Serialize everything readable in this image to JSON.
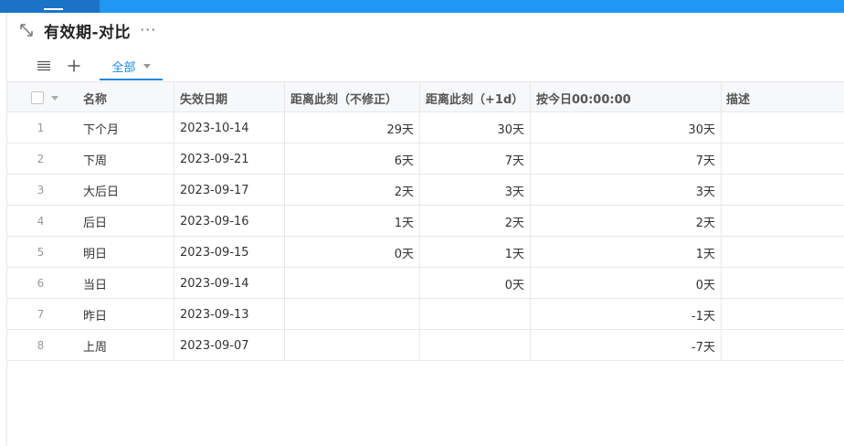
{
  "header": {
    "title": "有效期-对比",
    "more_label": "···"
  },
  "toolbar": {
    "view_tab_label": "全部"
  },
  "table": {
    "columns": [
      "名称",
      "失效日期",
      "距离此刻（不修正）",
      "距离此刻（+1d）",
      "按今日00:00:00",
      "描述"
    ],
    "rows": [
      {
        "index": "1",
        "name": "下个月",
        "date": "2023-10-14",
        "d1": "29天",
        "d2": "30天",
        "d3": "30天",
        "desc": ""
      },
      {
        "index": "2",
        "name": "下周",
        "date": "2023-09-21",
        "d1": "6天",
        "d2": "7天",
        "d3": "7天",
        "desc": ""
      },
      {
        "index": "3",
        "name": "大后日",
        "date": "2023-09-17",
        "d1": "2天",
        "d2": "3天",
        "d3": "3天",
        "desc": ""
      },
      {
        "index": "4",
        "name": "后日",
        "date": "2023-09-16",
        "d1": "1天",
        "d2": "2天",
        "d3": "2天",
        "desc": ""
      },
      {
        "index": "5",
        "name": "明日",
        "date": "2023-09-15",
        "d1": "0天",
        "d2": "1天",
        "d3": "1天",
        "desc": ""
      },
      {
        "index": "6",
        "name": "当日",
        "date": "2023-09-14",
        "d1": "",
        "d2": "0天",
        "d3": "0天",
        "desc": ""
      },
      {
        "index": "7",
        "name": "昨日",
        "date": "2023-09-13",
        "d1": "",
        "d2": "",
        "d3": "-1天",
        "desc": ""
      },
      {
        "index": "8",
        "name": "上周",
        "date": "2023-09-07",
        "d1": "",
        "d2": "",
        "d3": "-7天",
        "desc": ""
      }
    ]
  },
  "colors": {
    "topbar": "#2196f3",
    "accent": "#1e88e5",
    "border": "#e8e8e8",
    "header_bg": "#f7f8fa"
  },
  "icons": {
    "expand": "expand-diagonal-icon",
    "more": "more-dots-icon",
    "menu": "list-menu-icon",
    "add": "plus-icon",
    "caret": "caret-down-icon"
  }
}
